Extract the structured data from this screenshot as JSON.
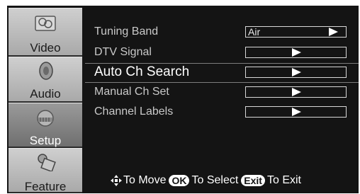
{
  "sidebar": {
    "items": [
      {
        "label": "Video",
        "icon": "video-icon"
      },
      {
        "label": "Audio",
        "icon": "speaker-icon"
      },
      {
        "label": "Setup",
        "icon": "setup-icon",
        "active": true
      },
      {
        "label": "Feature",
        "icon": "feature-icon"
      }
    ]
  },
  "menu": {
    "items": [
      {
        "label": "Tuning Band",
        "value": "Air"
      },
      {
        "label": "DTV Signal",
        "value": ""
      },
      {
        "label": "Auto Ch Search",
        "value": "",
        "selected": true
      },
      {
        "label": "Manual Ch Set",
        "value": ""
      },
      {
        "label": "Channel Labels",
        "value": ""
      }
    ]
  },
  "help": {
    "move_text": "To Move",
    "ok_key": "OK",
    "select_text": "To Select",
    "exit_key": "Exit",
    "exit_text": "To Exit"
  },
  "colors": {
    "background": "#141414",
    "sidebar": "#b8b8b8",
    "sidebar_active": "#7a7a7a",
    "text": "#c9c9c9",
    "highlight_text": "#ffffff"
  }
}
